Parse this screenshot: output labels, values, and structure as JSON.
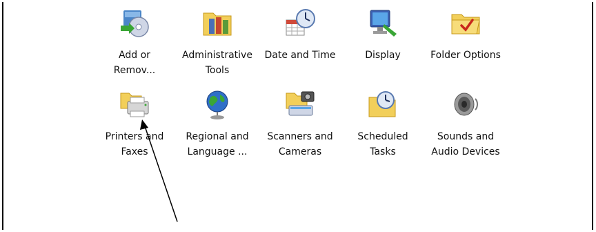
{
  "control_panel": {
    "items": [
      {
        "label": "Add or\nRemov...",
        "icon": "add-remove-programs-icon"
      },
      {
        "label": "Administrative\nTools",
        "icon": "administrative-tools-icon"
      },
      {
        "label": "Date and Time",
        "icon": "date-time-icon"
      },
      {
        "label": "Display",
        "icon": "display-icon"
      },
      {
        "label": "Folder Options",
        "icon": "folder-options-icon"
      },
      {
        "label": "Printers and\nFaxes",
        "icon": "printers-faxes-icon"
      },
      {
        "label": "Regional and\nLanguage ...",
        "icon": "regional-language-icon"
      },
      {
        "label": "Scanners and\nCameras",
        "icon": "scanners-cameras-icon"
      },
      {
        "label": "Scheduled\nTasks",
        "icon": "scheduled-tasks-icon"
      },
      {
        "label": "Sounds and\nAudio Devices",
        "icon": "sounds-audio-icon"
      }
    ]
  }
}
